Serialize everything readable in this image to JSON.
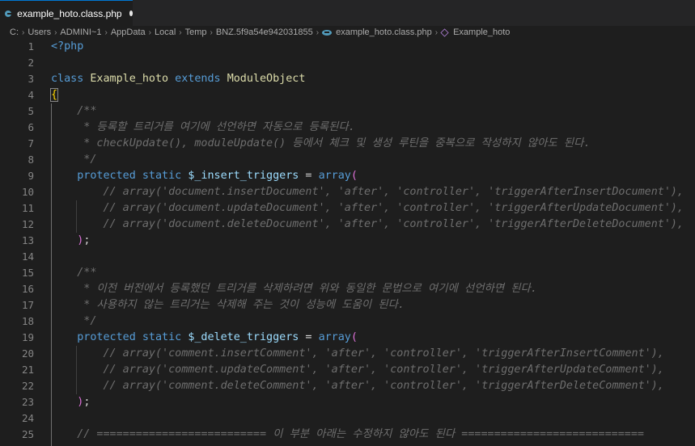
{
  "tab": {
    "filename": "example_hoto.class.php",
    "modified": true
  },
  "breadcrumb": {
    "segments": [
      "C:",
      "Users",
      "ADMINI~1",
      "AppData",
      "Local",
      "Temp",
      "BNZ.5f9a54e942031855"
    ],
    "file": "example_hoto.class.php",
    "symbol": "Example_hoto"
  },
  "editor": {
    "lines": [
      {
        "n": "1",
        "parts": [
          {
            "c": "t-tag",
            "t": "<?php"
          }
        ]
      },
      {
        "n": "2",
        "parts": []
      },
      {
        "n": "3",
        "parts": [
          {
            "c": "t-kw",
            "t": "class "
          },
          {
            "c": "t-cls",
            "t": "Example_hoto"
          },
          {
            "c": "t-kw",
            "t": " extends "
          },
          {
            "c": "t-cls",
            "t": "ModuleObject"
          }
        ]
      },
      {
        "n": "4",
        "parts": [
          {
            "c": "t-brace brace-box",
            "t": "{"
          }
        ]
      },
      {
        "n": "5",
        "parts": [
          {
            "c": "t-cmgray",
            "t": "    /**"
          }
        ]
      },
      {
        "n": "6",
        "parts": [
          {
            "c": "t-cmgray",
            "t": "     * 등록할 트리거를 여기에 선언하면 자동으로 등록된다."
          }
        ]
      },
      {
        "n": "7",
        "parts": [
          {
            "c": "t-cmgray",
            "t": "     * checkUpdate(), moduleUpdate() 등에서 체크 및 생성 루틴을 중복으로 작성하지 않아도 된다."
          }
        ]
      },
      {
        "n": "8",
        "parts": [
          {
            "c": "t-cmgray",
            "t": "     */"
          }
        ]
      },
      {
        "n": "9",
        "parts": [
          {
            "c": "t-kw",
            "t": "    protected static "
          },
          {
            "c": "t-var",
            "t": "$_insert_triggers"
          },
          {
            "c": "t-op",
            "t": " = "
          },
          {
            "c": "t-kw",
            "t": "array"
          },
          {
            "c": "t-paren",
            "t": "("
          }
        ]
      },
      {
        "n": "10",
        "parts": [
          {
            "c": "t-cmgray",
            "t": "        // array('document.insertDocument', 'after', 'controller', 'triggerAfterInsertDocument'),"
          }
        ]
      },
      {
        "n": "11",
        "parts": [
          {
            "c": "t-cmgray",
            "t": "        // array('document.updateDocument', 'after', 'controller', 'triggerAfterUpdateDocument'),"
          }
        ]
      },
      {
        "n": "12",
        "parts": [
          {
            "c": "t-cmgray",
            "t": "        // array('document.deleteDocument', 'after', 'controller', 'triggerAfterDeleteDocument'),"
          }
        ]
      },
      {
        "n": "13",
        "parts": [
          {
            "c": "t-paren",
            "t": "    )"
          },
          {
            "c": "t-op",
            "t": ";"
          }
        ]
      },
      {
        "n": "14",
        "parts": []
      },
      {
        "n": "15",
        "parts": [
          {
            "c": "t-cmgray",
            "t": "    /**"
          }
        ]
      },
      {
        "n": "16",
        "parts": [
          {
            "c": "t-cmgray",
            "t": "     * 이전 버전에서 등록했던 트리거를 삭제하려면 위와 동일한 문법으로 여기에 선언하면 된다."
          }
        ]
      },
      {
        "n": "17",
        "parts": [
          {
            "c": "t-cmgray",
            "t": "     * 사용하지 않는 트리거는 삭제해 주는 것이 성능에 도움이 된다."
          }
        ]
      },
      {
        "n": "18",
        "parts": [
          {
            "c": "t-cmgray",
            "t": "     */"
          }
        ]
      },
      {
        "n": "19",
        "parts": [
          {
            "c": "t-kw",
            "t": "    protected static "
          },
          {
            "c": "t-var",
            "t": "$_delete_triggers"
          },
          {
            "c": "t-op",
            "t": " = "
          },
          {
            "c": "t-kw",
            "t": "array"
          },
          {
            "c": "t-paren",
            "t": "("
          }
        ]
      },
      {
        "n": "20",
        "parts": [
          {
            "c": "t-cmgray",
            "t": "        // array('comment.insertComment', 'after', 'controller', 'triggerAfterInsertComment'),"
          }
        ]
      },
      {
        "n": "21",
        "parts": [
          {
            "c": "t-cmgray",
            "t": "        // array('comment.updateComment', 'after', 'controller', 'triggerAfterUpdateComment'),"
          }
        ]
      },
      {
        "n": "22",
        "parts": [
          {
            "c": "t-cmgray",
            "t": "        // array('comment.deleteComment', 'after', 'controller', 'triggerAfterDeleteComment'),"
          }
        ]
      },
      {
        "n": "23",
        "parts": [
          {
            "c": "t-paren",
            "t": "    )"
          },
          {
            "c": "t-op",
            "t": ";"
          }
        ]
      },
      {
        "n": "24",
        "parts": []
      },
      {
        "n": "25",
        "parts": [
          {
            "c": "t-cmgray",
            "t": "    // ========================== 이 부분 아래는 수정하지 않아도 된다 ============================"
          }
        ]
      }
    ]
  },
  "colors": {
    "background": "#1e1e1e",
    "keyword": "#569cd6",
    "class_name": "#dcdcaa",
    "variable": "#9cdcfe",
    "comment": "#6e6e6e",
    "brace": "#ffd700",
    "paren": "#da70d6"
  }
}
